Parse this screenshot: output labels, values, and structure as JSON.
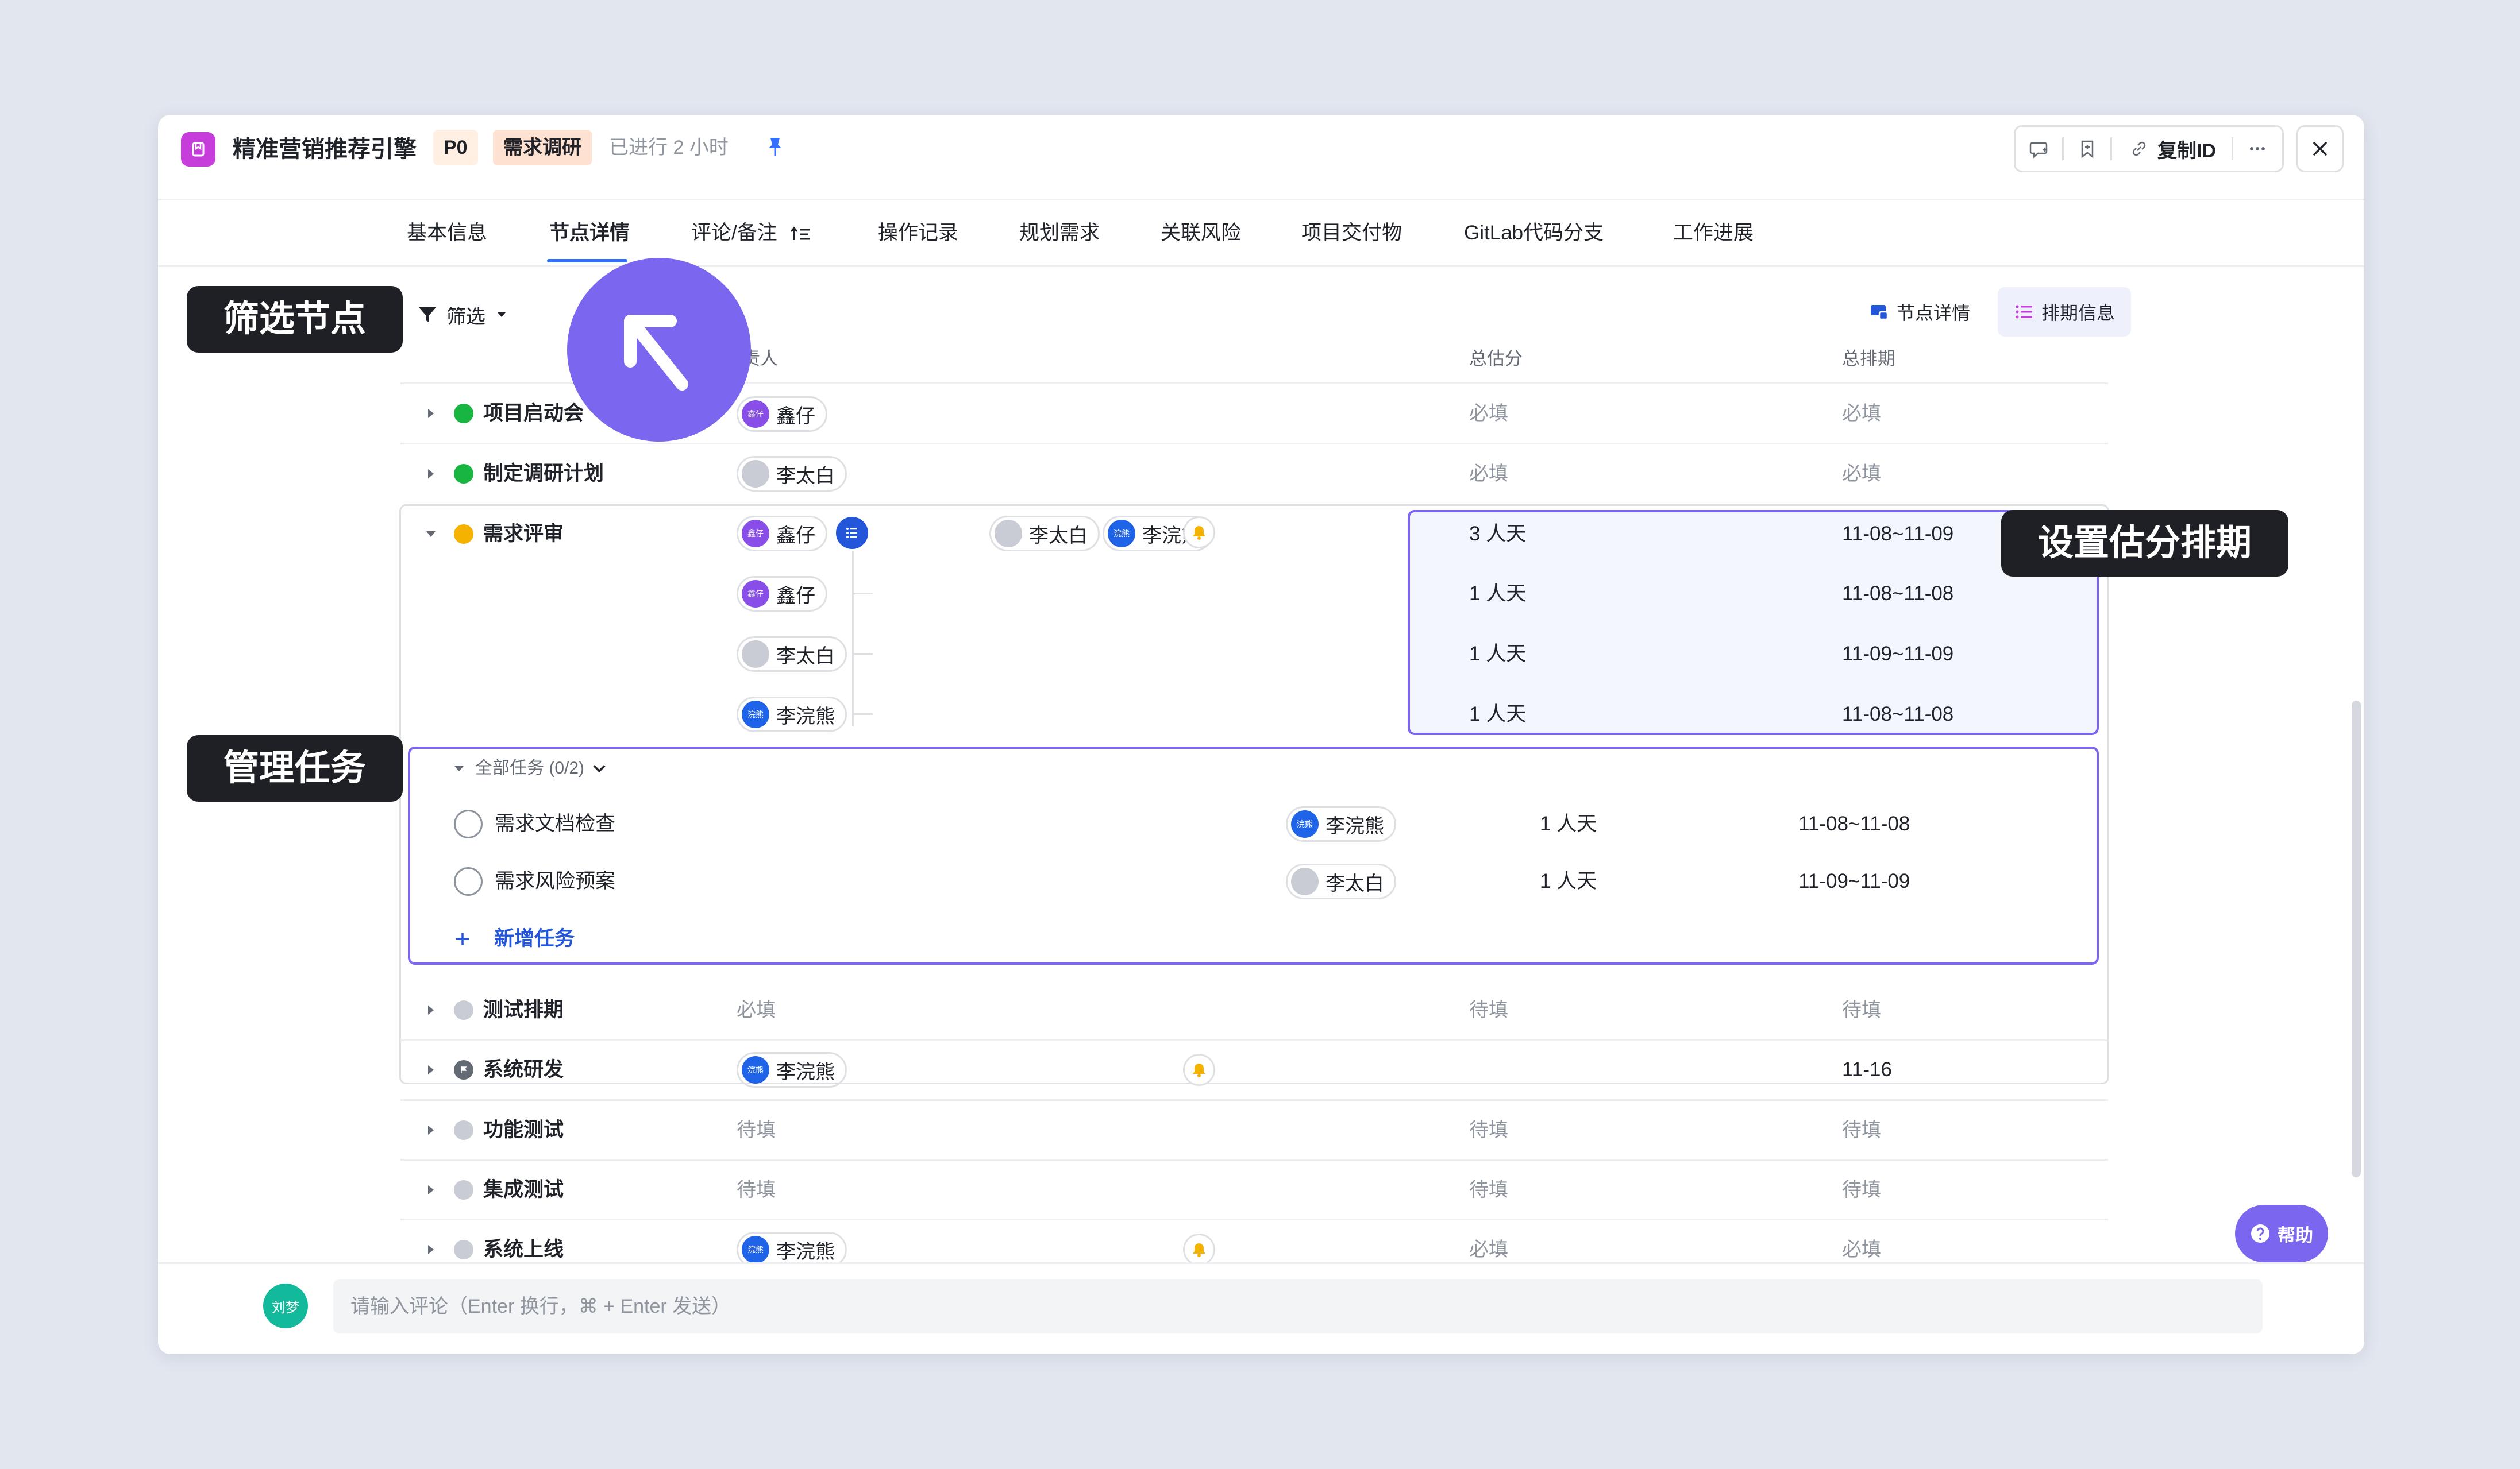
{
  "window": {
    "title": "精准营销推荐引擎",
    "priority": "P0",
    "stage": "需求调研",
    "elapsed": "已进行 2 小时",
    "copy_id_label": "复制ID"
  },
  "tabs": [
    {
      "label": "基本信息"
    },
    {
      "label": "节点详情",
      "active": true
    },
    {
      "label": "评论/备注"
    },
    {
      "label": "操作记录"
    },
    {
      "label": "规划需求"
    },
    {
      "label": "关联风险"
    },
    {
      "label": "项目交付物"
    },
    {
      "label": "GitLab代码分支"
    },
    {
      "label": "工作进展"
    }
  ],
  "filter": {
    "label": "筛选"
  },
  "view_toggles": {
    "node_detail": "节点详情",
    "schedule_info": "排期信息"
  },
  "columns": {
    "owner_partial": "责人",
    "total_estimate": "总估分",
    "total_schedule": "总排期"
  },
  "rows": [
    {
      "name": "项目启动会",
      "status": "completed",
      "assignees": [
        "鑫仔"
      ],
      "estimate": "必填",
      "schedule": "必填"
    },
    {
      "name": "制定调研计划",
      "status": "completed",
      "assignees": [
        "李太白"
      ],
      "estimate": "必填",
      "schedule": "必填"
    },
    {
      "name": "需求评审",
      "status": "in-progress",
      "assignees": [
        "鑫仔",
        "李太白",
        "李浣熊"
      ],
      "estimate": "3 人天",
      "schedule": "11-08~11-09",
      "sub_assignments": [
        {
          "assignee": "鑫仔",
          "estimate": "1 人天",
          "schedule": "11-08~11-08"
        },
        {
          "assignee": "李太白",
          "estimate": "1 人天",
          "schedule": "11-09~11-09"
        },
        {
          "assignee": "李浣熊",
          "estimate": "1 人天",
          "schedule": "11-08~11-08"
        }
      ]
    },
    {
      "name": "测试排期",
      "status": "pending",
      "owner": "必填",
      "estimate": "待填",
      "schedule": "待填"
    },
    {
      "name": "系统研发",
      "status": "blocked",
      "assignees": [
        "李浣熊"
      ],
      "estimate": "",
      "schedule": "11-16"
    },
    {
      "name": "功能测试",
      "status": "pending",
      "owner": "待填",
      "estimate": "待填",
      "schedule": "待填"
    },
    {
      "name": "集成测试",
      "status": "pending",
      "owner": "待填",
      "estimate": "待填",
      "schedule": "待填"
    },
    {
      "name": "系统上线",
      "status": "pending",
      "assignees": [
        "李浣熊"
      ],
      "estimate": "必填",
      "schedule": "必填"
    }
  ],
  "tasks": {
    "header": "全部任务 (0/2)",
    "items": [
      {
        "name": "需求文档检查",
        "assignee": "李浣熊",
        "estimate": "1 人天",
        "schedule": "11-08~11-08"
      },
      {
        "name": "需求风险预案",
        "assignee": "李太白",
        "estimate": "1 人天",
        "schedule": "11-09~11-09"
      }
    ],
    "add_label": "新增任务"
  },
  "avatar_text": {
    "xin": "鑫仔",
    "huan": "浣熊"
  },
  "comment": {
    "user": "刘梦",
    "placeholder": "请输入评论（Enter 换行，⌘ + Enter 发送）"
  },
  "help": {
    "label": "帮助"
  },
  "callouts": {
    "filter_nodes": "筛选节点",
    "manage_tasks": "管理任务",
    "set_schedule": "设置估分排期"
  },
  "colors": {
    "accent": "#7b66f0",
    "primary": "#3370ff",
    "done": "#18b640",
    "in_progress": "#f5b300",
    "pending": "#c9ccd4"
  }
}
